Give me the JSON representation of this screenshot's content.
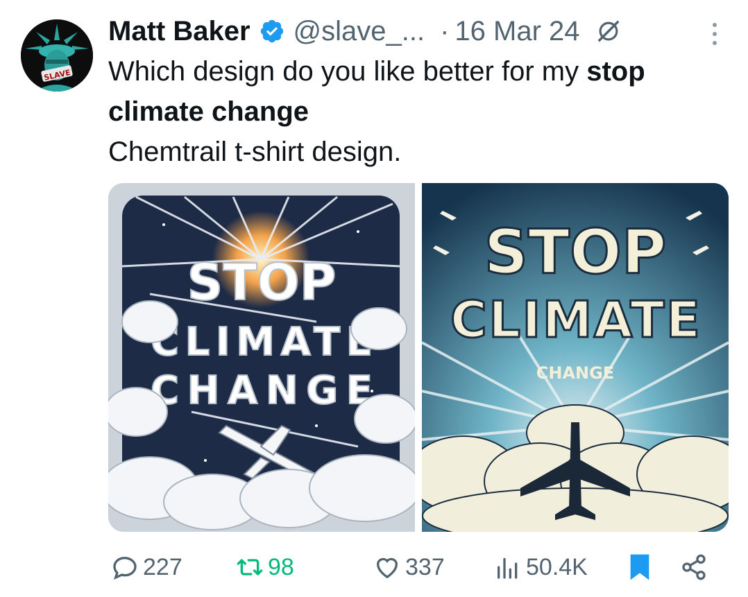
{
  "tweet": {
    "author_name": "Matt Baker",
    "author_handle": "@slave_...",
    "separator": "·",
    "date": "16 Mar 24",
    "text_normal_1": "Which design do you like better for my ",
    "text_bold": "stop climate change",
    "text_normal_2": "Chemtrail t-shirt design.",
    "avatar_badge_text": "SLAVE"
  },
  "media": {
    "left": {
      "word1": "STOP",
      "word2": "CLIMATE",
      "word3": "CHANGE"
    },
    "right": {
      "word1": "STOP",
      "word2": "CLIMATE",
      "word3": "CHANGE"
    }
  },
  "actions": {
    "replies": "227",
    "retweets": "98",
    "likes": "337",
    "views": "50.4K"
  },
  "colors": {
    "accent": "#1d9bf0",
    "retweet_green": "#00ba7c",
    "muted": "#536471",
    "text": "#0f1419"
  },
  "icons": {
    "verified": "verified-badge-icon",
    "grok": "grok-icon",
    "more": "more-dots-icon",
    "reply": "reply-icon",
    "retweet": "retweet-icon",
    "like": "heart-icon",
    "views": "views-icon",
    "bookmark": "bookmark-icon",
    "share": "share-icon"
  }
}
